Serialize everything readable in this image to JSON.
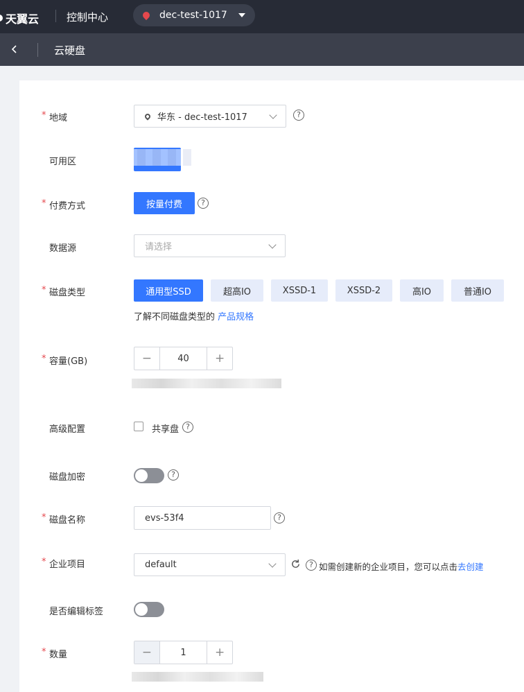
{
  "topbar": {
    "logo": "天翼云",
    "console_title": "控制中心",
    "region": "dec-test-1017"
  },
  "subbar": {
    "back_icon": "chevron-left-icon",
    "title": "云硬盘"
  },
  "form": {
    "region": {
      "label": "地域",
      "value": "华东 - dec-test-1017"
    },
    "az": {
      "label": "可用区"
    },
    "billing": {
      "label": "付费方式",
      "option": "按量付费"
    },
    "data_source": {
      "label": "数据源",
      "placeholder": "请选择"
    },
    "disk_type": {
      "label": "磁盘类型",
      "options": [
        "通用型SSD",
        "超高IO",
        "XSSD-1",
        "XSSD-2",
        "高IO",
        "普通IO"
      ],
      "selected": "通用型SSD",
      "hint": "了解不同磁盘类型的",
      "hint_link": "产品规格"
    },
    "capacity": {
      "label": "容量(GB)",
      "value": "40",
      "minus": "−",
      "plus": "+"
    },
    "advanced": {
      "label": "高级配置",
      "shared_label": "共享盘"
    },
    "encryption": {
      "label": "磁盘加密"
    },
    "disk_name": {
      "label": "磁盘名称",
      "value": "evs-53f4"
    },
    "project": {
      "label": "企业项目",
      "value": "default",
      "hint": "如需创建新的企业项目，您可以点击",
      "hint_link": "去创建"
    },
    "edit_tags": {
      "label": "是否编辑标签"
    },
    "quantity": {
      "label": "数量",
      "value": "1",
      "minus": "−",
      "plus": "+"
    },
    "required_mark": "*",
    "help_mark": "?"
  },
  "colors": {
    "primary": "#3377ff",
    "topbar": "#272b36",
    "subbar": "#3c404c",
    "required": "#e5484d"
  }
}
